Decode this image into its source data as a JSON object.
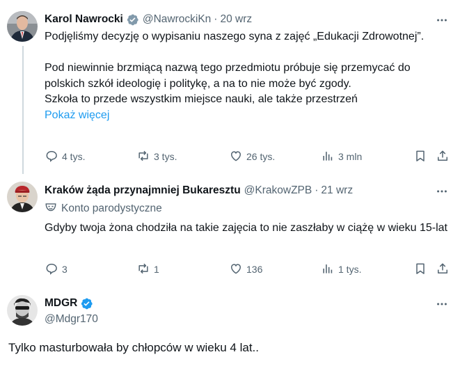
{
  "posts": [
    {
      "author": "Karol Nawrocki",
      "handle": "@NawrockiKn",
      "separator": "·",
      "time": "20 wrz",
      "paragraphs": [
        "Podjęliśmy decyzję o wypisaniu naszego syna z zajęć „Edukacji Zdrowotnej”.",
        "Pod niewinnie brzmiącą nazwą tego przedmiotu próbuje się przemycać do polskich szkół ideologię i politykę, a na to nie może być zgody.",
        "Szkoła to przede wszystkim miejsce nauki, ale także przestrzeń"
      ],
      "show_more": "Pokaż więcej",
      "replies": "4 tys.",
      "reposts": "3 tys.",
      "likes": "26 tys.",
      "views": "3 mln"
    },
    {
      "author": "Kraków żąda przynajmniej Bukaresztu",
      "handle": "@KrakowZPB",
      "separator": "·",
      "time": "21 wrz",
      "label": "Konto parodystyczne",
      "text": "Gdyby twoja żona chodziła na takie zajęcia to nie zaszłaby w ciążę w wieku 15-lat",
      "replies": "3",
      "reposts": "1",
      "likes": "136",
      "views": "1 tys."
    },
    {
      "author": "MDGR",
      "handle": "@Mdgr170",
      "text": "Tylko masturbowała by chłopców w wieku 4 lat.."
    }
  ],
  "colors": {
    "text": "#0f1419",
    "secondary": "#536471",
    "link": "#1d9bf0",
    "verified_blue": "#1d9bf0",
    "verified_gray": "#829aab",
    "thread_line": "#cfd9de"
  },
  "icons": [
    "verified-badge-icon",
    "more-icon",
    "reply-icon",
    "repost-icon",
    "like-icon",
    "views-icon",
    "bookmark-icon",
    "share-icon",
    "parody-mask-icon"
  ]
}
